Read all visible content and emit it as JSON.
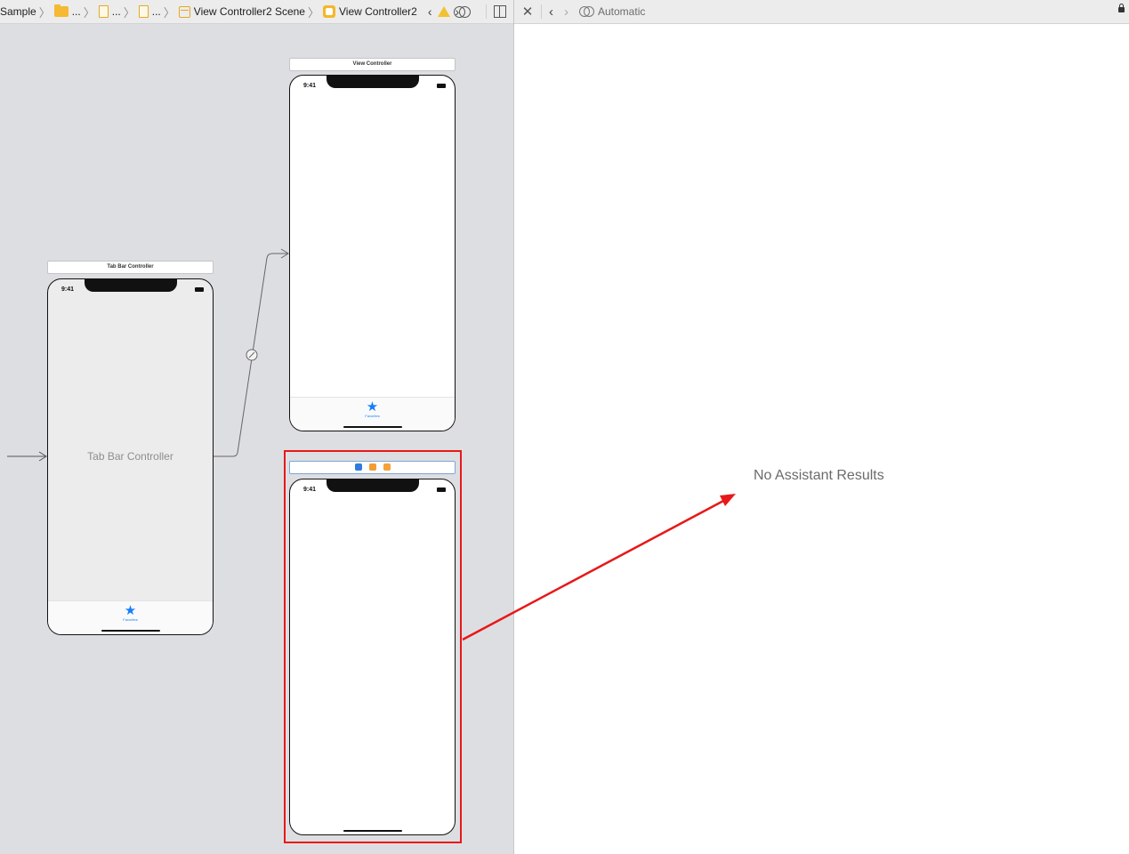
{
  "editor": {
    "breadcrumb": {
      "project": "Sample",
      "group": "...",
      "file1": "...",
      "file2": "...",
      "scene": "View Controller2 Scene",
      "controller": "View Controller2"
    }
  },
  "assistant": {
    "mode_label": "Automatic",
    "empty_message": "No Assistant Results"
  },
  "storyboard": {
    "tab_bar_controller": {
      "title": "Tab Bar Controller",
      "time": "9:41",
      "center_label": "Tab Bar Controller",
      "tab_item_label": "Favorites"
    },
    "view_controller": {
      "title": "View Controller",
      "time": "9:41",
      "tab_item_label": "Favorites"
    },
    "view_controller2": {
      "time": "9:41"
    }
  },
  "icons": {
    "tab_item": "star-icon",
    "segue": "relationship-segue-icon",
    "warning": "warning-icon"
  },
  "colors": {
    "accent": "#147efb",
    "annotation": "#e81818",
    "canvas": "#dddee2"
  }
}
